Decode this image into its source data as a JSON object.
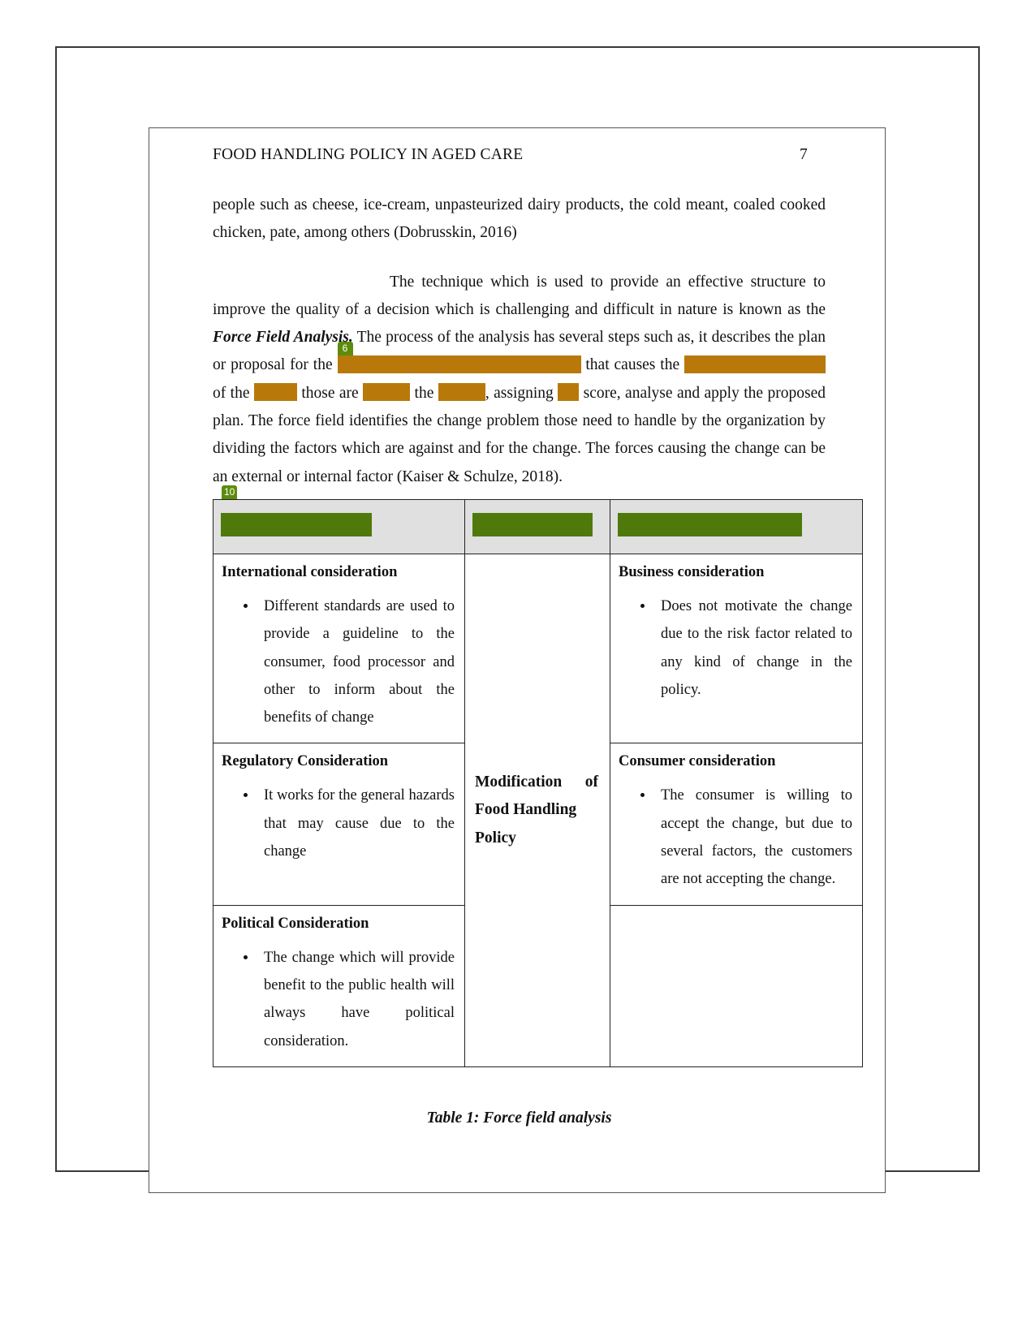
{
  "header": {
    "running_title": "FOOD HANDLING POLICY IN AGED CARE",
    "page_number": "7"
  },
  "body": {
    "para1": "people such as cheese, ice-cream, unpasteurized dairy products, the cold meant, coaled cooked chicken, pate, among others (Dobrusskin, 2016)",
    "para2_a": "The technique which is used to provide an effective structure to improve the quality of a decision which is challenging and difficult in nature is known as the ",
    "para2_emphasis": "Force Field Analysis.",
    "para2_b": " The process of the analysis has several steps such as, it describes the plan or proposal for the ",
    "para2_c": " that causes the ",
    "para2_d": " of the ",
    "para2_e": " those are ",
    "para2_f": " the ",
    "para2_g": ", assigning ",
    "para2_h": " score, analyse and apply the proposed plan. The force field identifies the change problem those need to handle by the organization by dividing the factors which are against and for the change. The forces causing the change can be an external or internal factor (Kaiser & Schulze, 2018)."
  },
  "redactions": {
    "color_orange": "#b8790a",
    "color_green": "#4f7a0b",
    "badge_paragraph": "6",
    "badge_table": "10"
  },
  "table": {
    "header_cells": [
      "",
      "",
      ""
    ],
    "rows": [
      {
        "left_title": "International consideration",
        "left_bullets": [
          "Different standards are used to provide a guideline to the consumer, food processor and other to inform about the benefits of change"
        ],
        "right_title": "Business consideration",
        "right_bullets": [
          "Does not motivate the change due to the risk factor related to any kind of change in the policy."
        ]
      },
      {
        "left_title": "Regulatory Consideration",
        "left_bullets": [
          "It works for the general hazards that may cause due to the change"
        ],
        "right_title": "Consumer consideration",
        "right_bullets": [
          "The consumer is willing to accept the change, but due to several factors, the customers are not accepting the change."
        ]
      },
      {
        "left_title": "Political Consideration",
        "left_bullets": [
          "The change which will provide benefit to the public health will always have political consideration."
        ],
        "right_title": "",
        "right_bullets": []
      }
    ],
    "center_text_line1": "Modification of",
    "center_text_line2": "Food Handling",
    "center_text_line3": "Policy",
    "caption": "Table 1: Force field analysis"
  }
}
